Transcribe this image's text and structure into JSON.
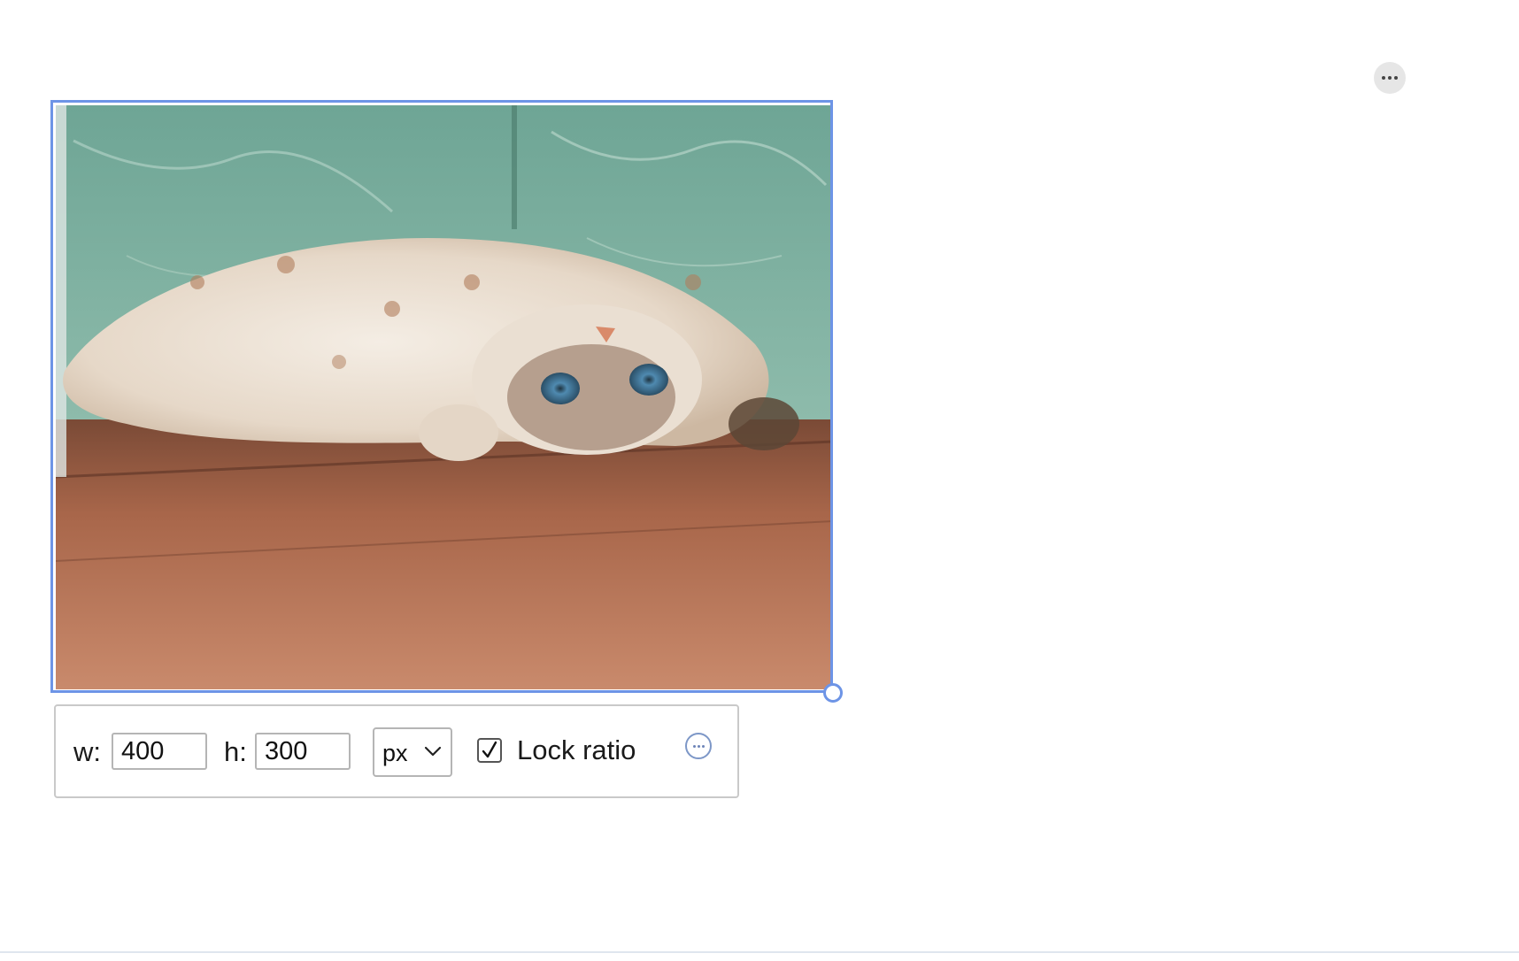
{
  "image": {
    "alt": "Cat lying upside down on a wooden floor"
  },
  "toolbar": {
    "width_label": "w:",
    "width_value": "400",
    "height_label": "h:",
    "height_value": "300",
    "unit": "px",
    "lock_ratio_label": "Lock ratio",
    "lock_ratio_checked": true
  },
  "icons": {
    "top_more": "more-horizontal-icon",
    "toolbar_more": "more-horizontal-circle-icon",
    "unit_dropdown": "chevron-down-icon",
    "lock_check": "checkmark-icon",
    "resize": "resize-handle"
  },
  "colors": {
    "selection_accent": "#6d94e6",
    "more_button_bg": "#e6e6e6"
  }
}
